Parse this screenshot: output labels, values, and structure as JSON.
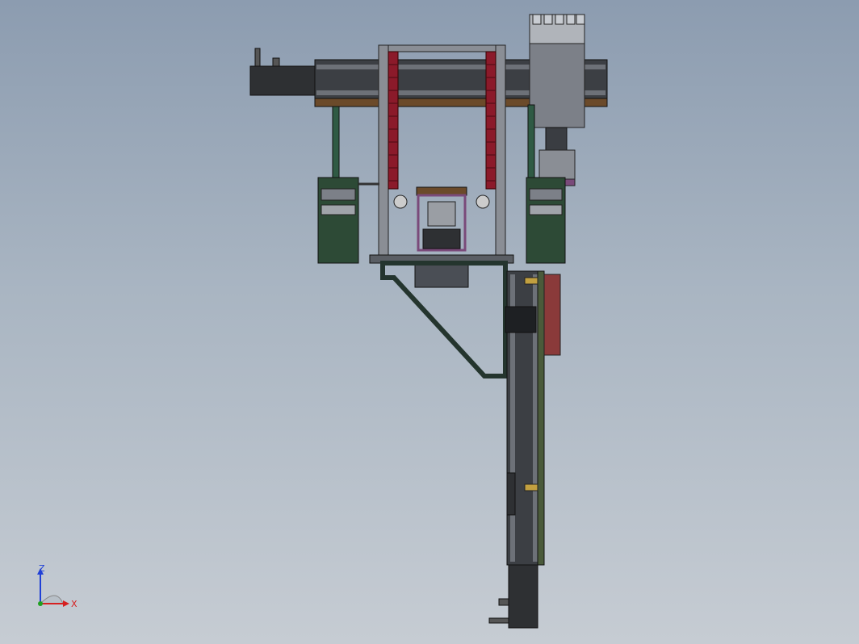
{
  "colors": {
    "background_top": "#8c9cb0",
    "background_bottom": "#c6ccd3",
    "frame_gray": "#7c8088",
    "dark_gray": "#3a3d42",
    "beam_dark": "#2e3033",
    "chain_red": "#8b1a2a",
    "support_green": "#2f5a44",
    "bracket_brown": "#6b4a2a",
    "pad_purple": "#7a4a7a",
    "axis_x": "#d62020",
    "axis_y": "#20a020",
    "axis_z": "#2040d6"
  },
  "triad": {
    "z_label": "Z",
    "x_label": "X"
  }
}
